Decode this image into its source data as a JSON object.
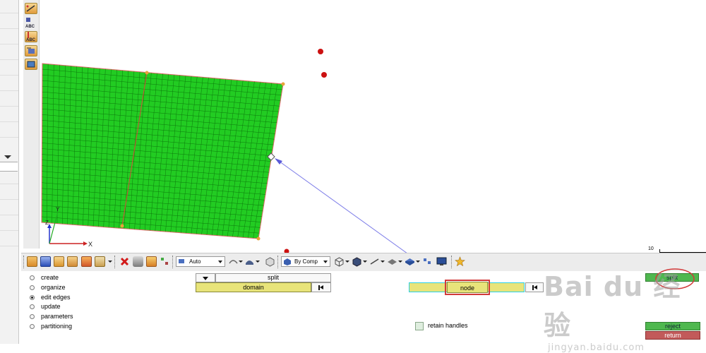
{
  "viewport": {
    "axis_z": "Z",
    "axis_y": "Y",
    "axis_x": "X",
    "mesh_color": "#22cc22",
    "scale_label": "10"
  },
  "left_toolbar": {
    "icons": [
      "align-icon",
      "text-label-icon",
      "numbers-icon",
      "view-icon",
      "card-icon"
    ],
    "label_abc_1": "ABC",
    "label_abc_2": "ABC"
  },
  "toolbar": {
    "auto_select": "Auto",
    "by_comp_select": "By Comp"
  },
  "panel": {
    "radio_options": [
      {
        "label": "create",
        "selected": false
      },
      {
        "label": "organize",
        "selected": false
      },
      {
        "label": "edit edges",
        "selected": true
      },
      {
        "label": "update",
        "selected": false
      },
      {
        "label": "parameters",
        "selected": false
      },
      {
        "label": "partitioning",
        "selected": false
      }
    ],
    "split_dropdown": "split",
    "domain_button": "domain",
    "node_button": "node",
    "retain_handles": "retain handles",
    "split_button": "split",
    "reject_button": "reject",
    "return_button": "return"
  },
  "watermark": {
    "brand": "Bai du 经验",
    "url": "jingyan.baidu.com"
  }
}
